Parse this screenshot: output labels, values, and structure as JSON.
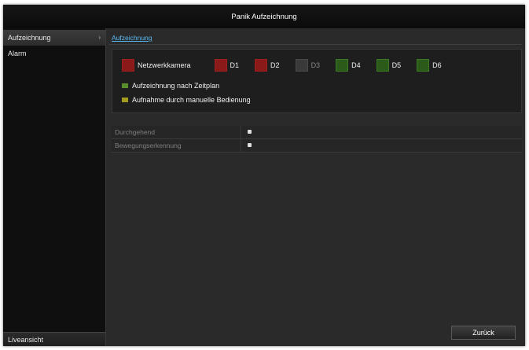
{
  "window": {
    "title": "Panik Aufzeichnung"
  },
  "sidebar": {
    "items": [
      {
        "label": "Aufzeichnung",
        "active": true,
        "arrow": "›"
      },
      {
        "label": "Alarm",
        "active": false
      }
    ],
    "footer": "Liveansicht"
  },
  "main": {
    "tab": "Aufzeichnung",
    "cameras": [
      {
        "label": "Netzwerkkamera",
        "color": "#8a1a1a"
      },
      {
        "label": "D1",
        "color": "#8a1a1a"
      },
      {
        "label": "D2",
        "color": "#8a1a1a"
      },
      {
        "label": "D3",
        "color": "#3a3a3a"
      },
      {
        "label": "D4",
        "color": "#2b5a1a"
      },
      {
        "label": "D5",
        "color": "#2b5a1a"
      },
      {
        "label": "D6",
        "color": "#2b5a1a"
      }
    ],
    "legend": [
      {
        "label": "Aufzeichnung nach Zeitplan",
        "color": "#5a8d2b"
      },
      {
        "label": "Aufnahme durch manuelle Bedienung",
        "color": "#a39a20"
      }
    ],
    "rows": [
      {
        "label": "Durchgehend"
      },
      {
        "label": "Bewegungserkennung"
      }
    ],
    "back_label": "Zurück"
  }
}
